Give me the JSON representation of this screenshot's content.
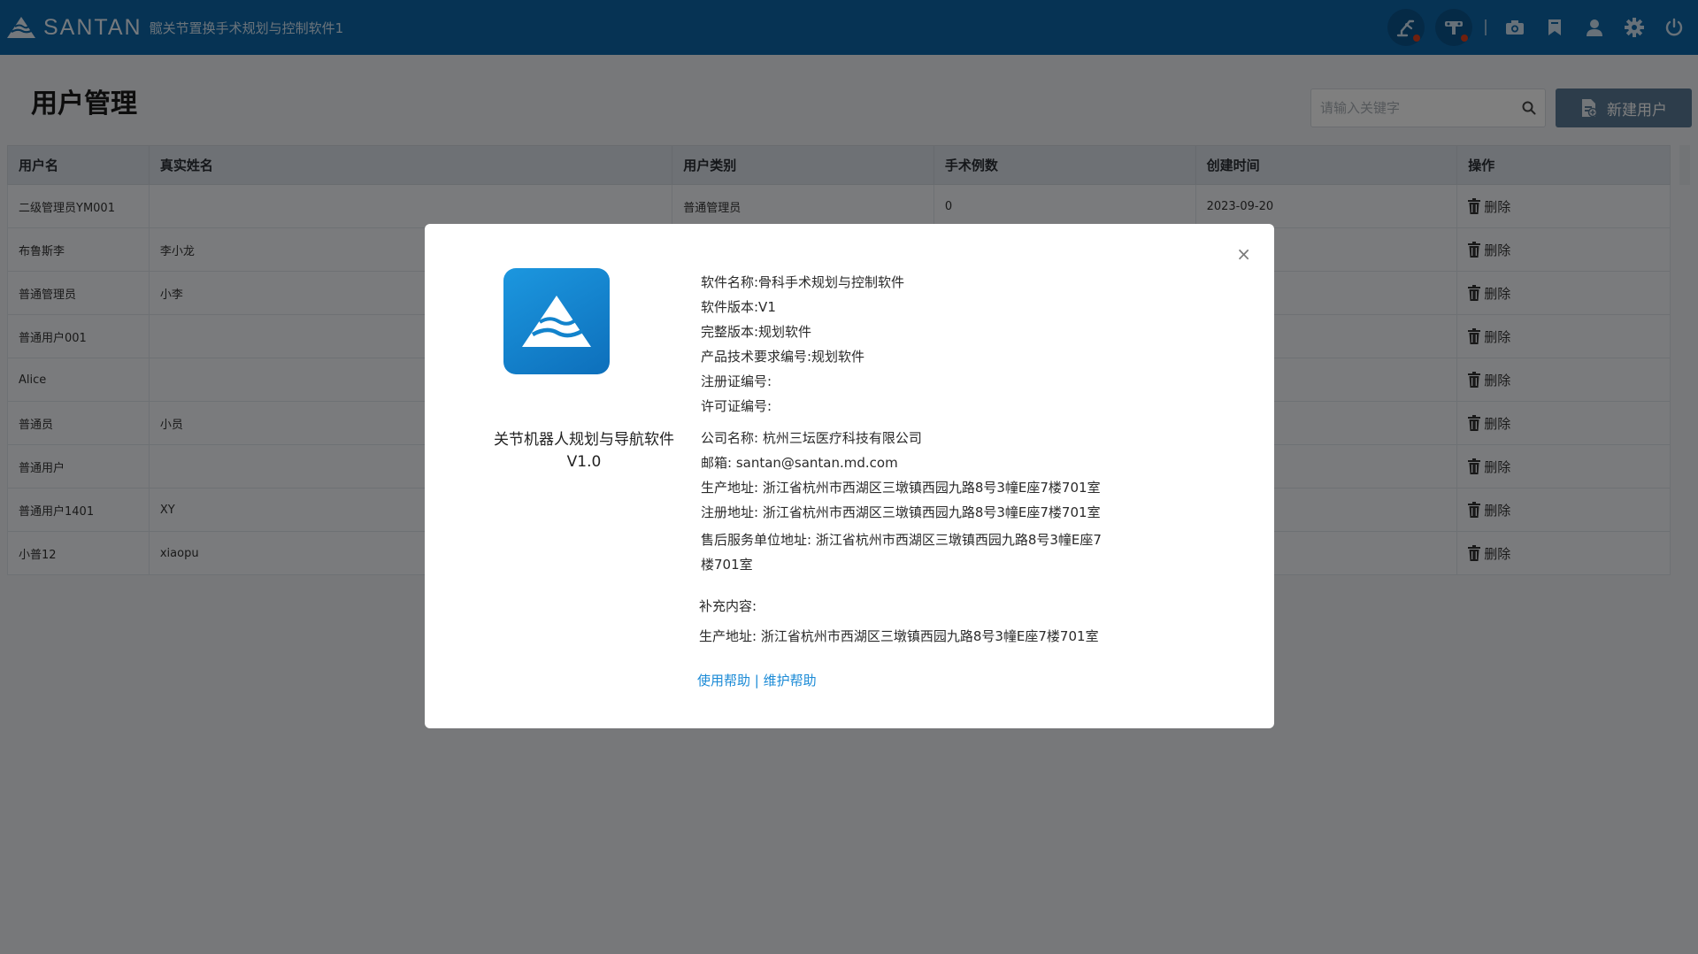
{
  "header": {
    "brand": "SANTAN",
    "app_title": "髋关节置换手术规划与控制软件1",
    "icons": [
      "robot-arm-icon",
      "camera-robot-icon",
      "camera-icon",
      "bookmark-icon",
      "user-icon",
      "gear-icon",
      "power-icon"
    ]
  },
  "page": {
    "title": "用户管理",
    "search_placeholder": "请输入关键字",
    "new_user_label": "新建用户"
  },
  "table": {
    "headers": [
      "用户名",
      "真实姓名",
      "用户类别",
      "手术例数",
      "创建时间",
      "操作"
    ],
    "rows": [
      {
        "username": "二级管理员YM001",
        "realname": "",
        "category": "普通管理员",
        "count": "0",
        "created": "2023-09-20",
        "action": "删除"
      },
      {
        "username": "布鲁斯李",
        "realname": "李小龙",
        "category": "",
        "count": "",
        "created": "",
        "action": "删除"
      },
      {
        "username": "普通管理员",
        "realname": "小李",
        "category": "",
        "count": "",
        "created": "",
        "action": "删除"
      },
      {
        "username": "普通用户001",
        "realname": "",
        "category": "",
        "count": "",
        "created": "",
        "action": "删除"
      },
      {
        "username": "Alice",
        "realname": "",
        "category": "",
        "count": "",
        "created": "",
        "action": "删除"
      },
      {
        "username": "普通员",
        "realname": "小员",
        "category": "",
        "count": "",
        "created": "",
        "action": "删除"
      },
      {
        "username": "普通用户",
        "realname": "",
        "category": "",
        "count": "",
        "created": "",
        "action": "删除"
      },
      {
        "username": "普通用户1401",
        "realname": "XY",
        "category": "",
        "count": "",
        "created": "",
        "action": "删除"
      },
      {
        "username": "小普12",
        "realname": "xiaopu",
        "category": "",
        "count": "",
        "created": "",
        "action": "删除"
      }
    ]
  },
  "modal": {
    "close": "×",
    "app_name_line1": "关节机器人规划与导航软件",
    "app_name_line2": "V1.0",
    "software_name": "软件名称:骨科手术规划与控制软件",
    "software_version": "软件版本:V1",
    "full_version": "完整版本:规划软件",
    "product_tech_no": "产品技术要求编号:规划软件",
    "registration_no": "注册证编号:",
    "license_no": "许可证编号:",
    "company": "公司名称: 杭州三坛医疗科技有限公司",
    "email": "邮箱: santan@santan.md.com",
    "production_address": "生产地址: 浙江省杭州市西湖区三墩镇西园九路8号3幢E座7楼701室",
    "registered_address": "注册地址: 浙江省杭州市西湖区三墩镇西园九路8号3幢E座7楼701室",
    "service_address_line1": "售后服务单位地址: 浙江省杭州市西湖区三墩镇西园九路8号3幢E座7",
    "service_address_line2": "楼701室",
    "supplement_label": "补充内容:",
    "supplement_address": "生产地址: 浙江省杭州市西湖区三墩镇西园九路8号3幢E座7楼701室",
    "help_link": "使用帮助",
    "link_separator": "|",
    "maintenance_link": "维护帮助"
  },
  "colors": {
    "topbar": "#0d66a9",
    "button": "#5b7a96",
    "link": "#1a8ad6",
    "status_dot": "#e0401d"
  }
}
